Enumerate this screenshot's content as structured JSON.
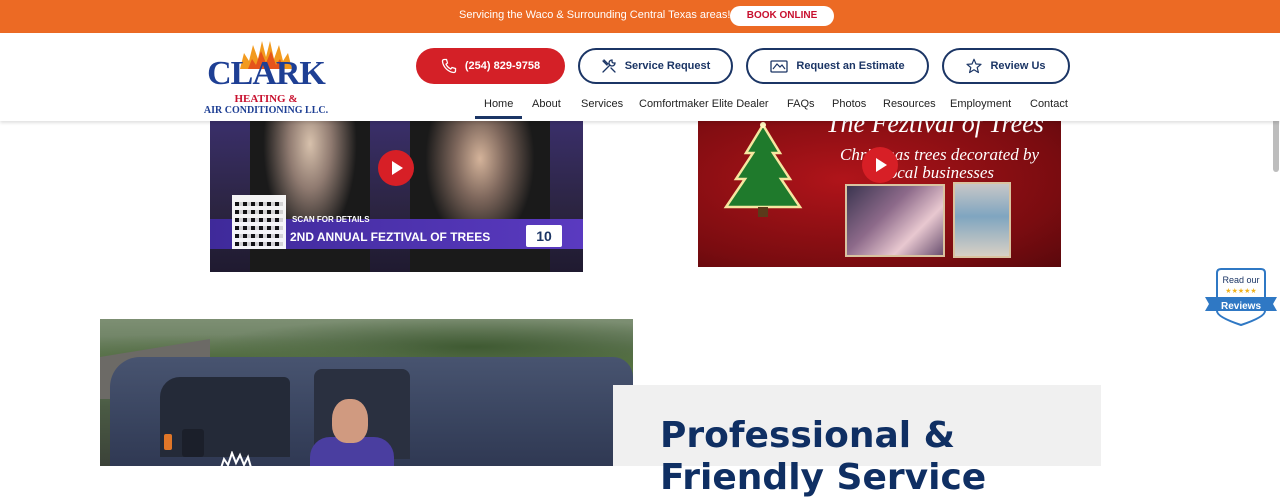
{
  "topbar": {
    "message": "Servicing the Waco & Surrounding Central Texas areas!",
    "book_label": "BOOK ONLINE"
  },
  "logo": {
    "line1": "CLARK",
    "line2": "HEATING &",
    "line3": "AIR CONDITIONING LLC."
  },
  "header_buttons": {
    "phone": "(254) 829-9758",
    "service_request": "Service Request",
    "estimate": "Request an Estimate",
    "review": "Review Us"
  },
  "nav": {
    "items": [
      "Home",
      "About",
      "Services",
      "Comfortmaker Elite Dealer",
      "FAQs",
      "Photos",
      "Resources",
      "Employment",
      "Contact"
    ],
    "active": "Home"
  },
  "video1": {
    "scan_text": "SCAN FOR DETAILS",
    "headline": "2ND ANNUAL FEZTIVAL OF TREES",
    "station": "10"
  },
  "video2": {
    "title": "The Feztival of Trees",
    "subtitle_line1": "Christmas trees decorated by",
    "subtitle_line2": "local businesses"
  },
  "reviews_badge": {
    "top": "Read our",
    "stars": "★★★★★",
    "bottom": "Reviews"
  },
  "section": {
    "heading": "Professional & Friendly Service"
  },
  "colors": {
    "topbar": "#ec6a24",
    "brand_red": "#d42027",
    "brand_navy": "#1b3565",
    "heading_navy": "#0f2f63"
  }
}
